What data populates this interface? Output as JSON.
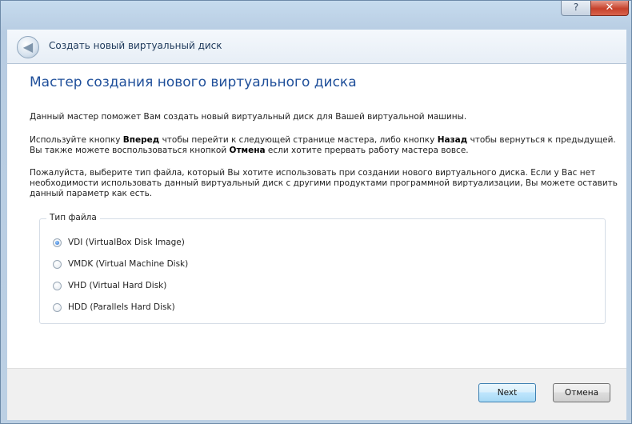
{
  "window": {
    "title": "Создать новый виртуальный диск",
    "help_glyph": "?",
    "close_glyph": "✕",
    "back_glyph": "◀"
  },
  "wizard": {
    "heading": "Мастер создания нового виртуального диска",
    "paragraph1": "Данный мастер поможет Вам создать новый виртуальный диск для Вашей виртуальной машины.",
    "paragraph2": {
      "part1": "Используйте кнопку ",
      "bold1": "Вперед",
      "part2": " чтобы перейти к следующей странице мастера, либо кнопку ",
      "bold2": "Назад",
      "part3": " чтобы вернуться к предыдущей. Вы также можете воспользоваться кнопкой ",
      "bold3": "Отмена",
      "part4": " если хотите прервать работу мастера вовсе."
    },
    "paragraph3": "Пожалуйста, выберите тип файла, который Вы хотите использовать при создании нового виртуального диска. Если у Вас нет необходимости использовать данный виртуальный диск с другими продуктами программной виртуализации, Вы можете оставить данный параметр как есть."
  },
  "file_type": {
    "legend": "Тип файла",
    "options": [
      {
        "label": "VDI (VirtualBox Disk Image)",
        "checked": true
      },
      {
        "label": "VMDK (Virtual Machine Disk)",
        "checked": false
      },
      {
        "label": "VHD (Virtual Hard Disk)",
        "checked": false
      },
      {
        "label": "HDD (Parallels Hard Disk)",
        "checked": false
      }
    ]
  },
  "footer": {
    "next_label": "Next",
    "cancel_label": "Отмена"
  },
  "colors": {
    "heading": "#1f4f9a",
    "default_button_border": "#3c7fb1"
  }
}
